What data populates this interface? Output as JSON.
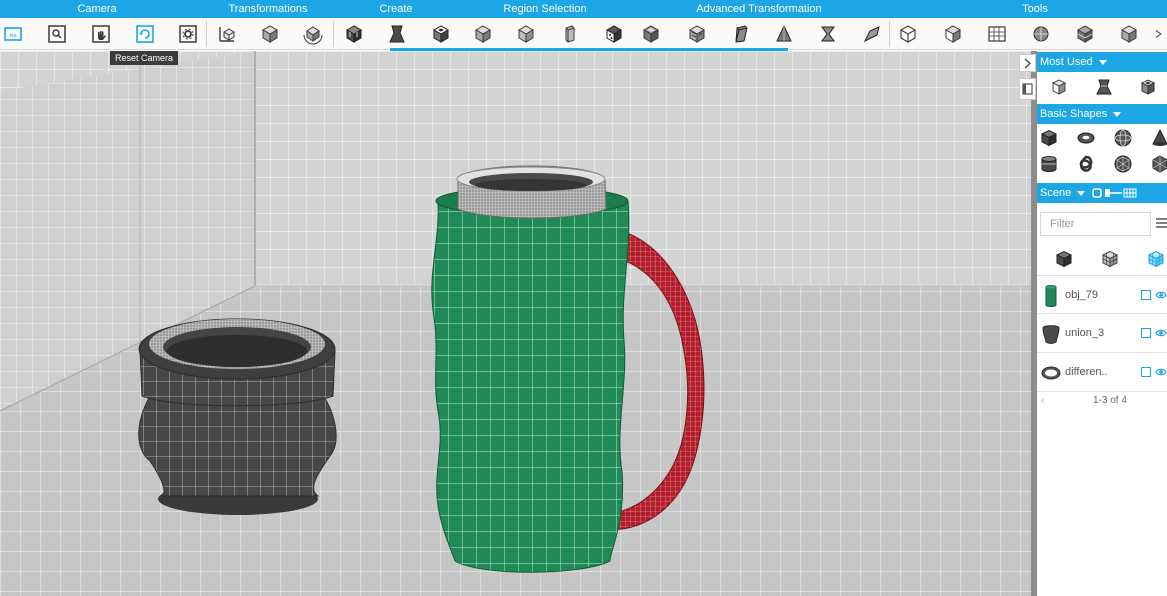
{
  "toolbar": {
    "tabs": [
      {
        "label": "Camera"
      },
      {
        "label": "Transformations"
      },
      {
        "label": "Create"
      },
      {
        "label": "Region Selection"
      },
      {
        "label": "Advanced Transformation"
      },
      {
        "label": "Tools"
      }
    ],
    "icons": [
      "home-view-icon",
      "zoom-icon",
      "pan-hand-icon",
      "reset-camera-icon",
      "camera-settings-icon",
      "transform-icon",
      "box-icon",
      "rotate-box-icon",
      "cube-icon",
      "extrude-icon",
      "open-box-icon",
      "box-icon",
      "box-icon",
      "half-box-icon",
      "dice-icon",
      "select-region-icon",
      "select-region-icon",
      "skew-box-icon",
      "taper-icon",
      "twist-icon",
      "bend-icon",
      "wire-box-icon",
      "grid-box-icon",
      "sphere-icon",
      "mesh-icon",
      "cube-icon"
    ],
    "tooltip": "Reset Camera",
    "accent_color": "#1ca6e6"
  },
  "panel": {
    "most_used": {
      "title": "Most Used",
      "icons": [
        "box-icon",
        "extrude-icon",
        "cube-icon"
      ]
    },
    "basic_shapes": {
      "title": "Basic Shapes",
      "icons": [
        "cube-shape-icon",
        "torus-shape-icon",
        "sphere-shape-icon",
        "cone-shape-icon",
        "cylinder-shape-icon",
        "knot-shape-icon",
        "geosphere-shape-icon",
        "icosahedron-shape-icon"
      ]
    },
    "scene": {
      "title": "Scene",
      "filter_placeholder": "Filter",
      "objects": [
        {
          "name": "obj_79",
          "color": "#1f8a55"
        },
        {
          "name": "union_3",
          "color": "#4a4a4a"
        },
        {
          "name": "differen..",
          "color": "#555555"
        }
      ],
      "pager": "1-3 of 4"
    }
  },
  "scene_colors": {
    "mug_body": "#1f8a55",
    "handle": "#b21e2c",
    "pot": "#464646",
    "floor": "#c9c9c9"
  }
}
